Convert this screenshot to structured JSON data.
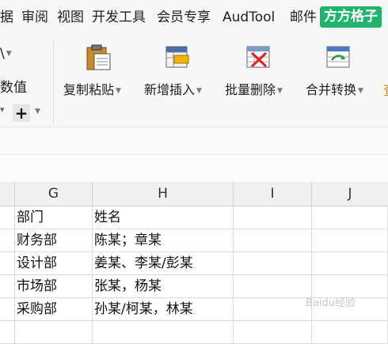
{
  "tabs": [
    "据",
    "审阅",
    "视图",
    "开发工具",
    "会员专享",
    "AudTool",
    "邮件",
    "方方格子"
  ],
  "ribbon": {
    "partial_top": "\\",
    "partial_mid": "数值",
    "buttons": [
      {
        "label": "复制粘贴",
        "icon": "clipboard-paste-icon"
      },
      {
        "label": "新增插入",
        "icon": "insert-rows-icon"
      },
      {
        "label": "批量删除",
        "icon": "delete-table-icon"
      },
      {
        "label": "合并转换",
        "icon": "merge-convert-icon"
      }
    ],
    "partial_right": "查"
  },
  "columns": [
    "G",
    "H",
    "I",
    "J"
  ],
  "rows": [
    [
      "部门",
      "姓名"
    ],
    [
      "财务部",
      "陈某；章某"
    ],
    [
      "设计部",
      "姜某、李某/彭某"
    ],
    [
      "市场部",
      "张某，杨某"
    ],
    [
      "采购部",
      "孙某/柯某，林某"
    ]
  ],
  "watermark": "Baidu经验"
}
